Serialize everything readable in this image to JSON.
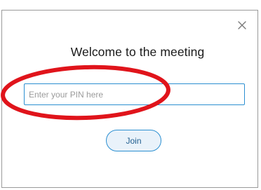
{
  "dialog": {
    "title": "Welcome to the meeting",
    "close_icon": "close-icon",
    "pin_input": {
      "value": "",
      "placeholder": "Enter your PIN here"
    },
    "join_label": "Join"
  },
  "colors": {
    "accent": "#2b8fd1",
    "button_fill": "#e9f2fa",
    "button_text": "#1f5d8f",
    "annotation": "#e0141b"
  }
}
